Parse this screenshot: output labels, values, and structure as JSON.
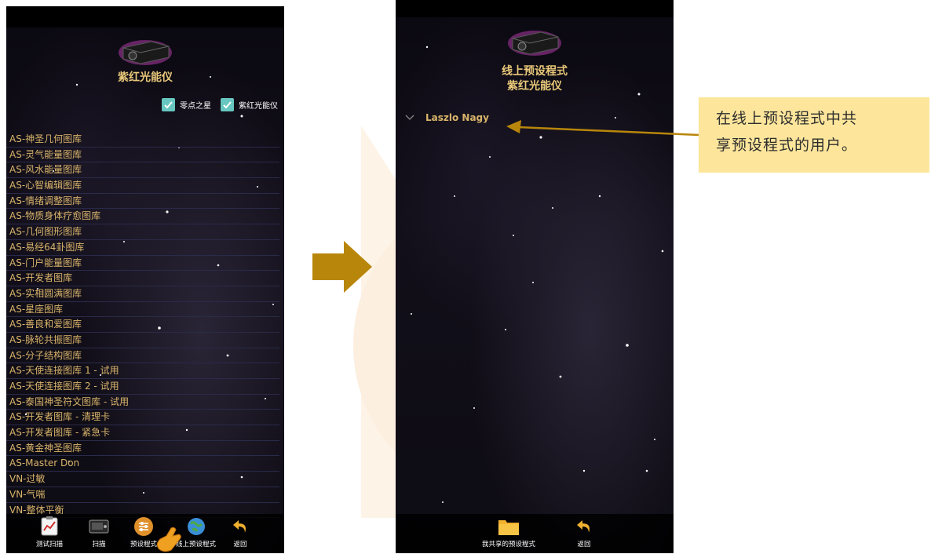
{
  "left_screen": {
    "title": "紫红光能仪",
    "checkboxes": [
      {
        "label": "零点之星",
        "checked": true
      },
      {
        "label": "紫红光能仪",
        "checked": true
      }
    ],
    "libraries": [
      "AS-神圣几何图库",
      "AS-灵气能量图库",
      "AS-风水能量图库",
      "AS-心智编辑图库",
      "AS-情绪调整图库",
      "AS-物质身体疗愈图库",
      "AS-几何图形图库",
      "AS-易经64卦图库",
      "AS-门户能量图库",
      "AS-开发者图库",
      "AS-实相圆满图库",
      "AS-星座图库",
      "AS-善良和爱图库",
      "AS-脉轮共振图库",
      "AS-分子结构图库",
      "AS-天使连接图库 1 - 试用",
      "AS-天使连接图库 2 - 试用",
      "AS-泰国神圣符文图库 - 试用",
      "AS-开发者图库 - 清理卡",
      "AS-开发者图库 - 紧急卡",
      "AS-黄金神圣图库",
      "AS-Master Don",
      "VN-过敏",
      "VN-气喘",
      "VN-整体平衡"
    ],
    "nav": [
      {
        "label": "测试扫描",
        "icon": "clipboard-chart-icon"
      },
      {
        "label": "扫描",
        "icon": "scanner-device-icon"
      },
      {
        "label": "预设程式",
        "icon": "sliders-icon"
      },
      {
        "label": "线上预设程式",
        "icon": "globe-icon"
      },
      {
        "label": "返回",
        "icon": "back-arrow-icon"
      }
    ]
  },
  "right_screen": {
    "title_line1": "线上预设程式",
    "title_line2": "紫红光能仪",
    "preset_user": "Laszlo Nagy",
    "nav": [
      {
        "label": "我共享的预设程式",
        "icon": "folder-icon"
      },
      {
        "label": "返回",
        "icon": "back-arrow-icon"
      }
    ]
  },
  "callout": {
    "line1": "在线上预设程式中共",
    "line2": "享预设程式的用户。"
  },
  "colors": {
    "accent_gold": "#e9c879",
    "list_text": "#d9b46a",
    "checkbox": "#67c7c0",
    "callout_bg": "#fde69c",
    "arrow": "#b8860b"
  }
}
